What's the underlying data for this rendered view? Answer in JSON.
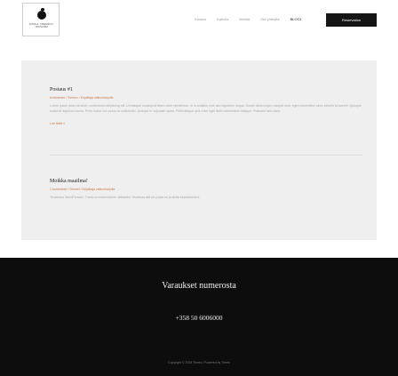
{
  "header": {
    "logo_text": "KAHVILA · OMENAPUU · SIILINJÄRVI",
    "nav": [
      {
        "label": "Etusivu"
      },
      {
        "label": "Kahvila"
      },
      {
        "label": "Meistä"
      },
      {
        "label": "Ota yhteyttä"
      },
      {
        "label": "BLOGI"
      }
    ],
    "reserve_label": "Reservation"
  },
  "posts": [
    {
      "title": "Postaus #1",
      "meta": "kommentoi / Yleinen / Kirjoittaja valtionharjoite",
      "excerpt": "Lorem ipsum dolor sit amet, consectetur adipiscing elit. Ut tristique consequat libero vitae elementum. In in sodales erat, sed dignissim neque. Donec ullamcorper volutpat sem, eget consectetur tortor lobortis ut laoreet. Quisque euismod dapibus mauris. Proin luctus non purus ac sollicitudin. Quisque in vulputate quam. Pellentesque quis enim eget libero elementum tristique. Praesent sem diam.",
      "read_more": "Lue lisää »"
    },
    {
      "title": "Moikka maailma!",
      "meta": "1 kommentti / Yleinen / Kirjoittaja valtionharjoite",
      "excerpt": "Tervetuloa WordPressiin. Tämä on ensimmäinen artikkelisi. Muokkaa sitä tai poista se ja aloita kirjoittaminen!",
      "read_more": ""
    }
  ],
  "footer": {
    "title": "Varaukset numerosta",
    "phone": "+358 50 6006000",
    "copyright": "Copyright © 2024 Theek | Powered by Theek"
  }
}
